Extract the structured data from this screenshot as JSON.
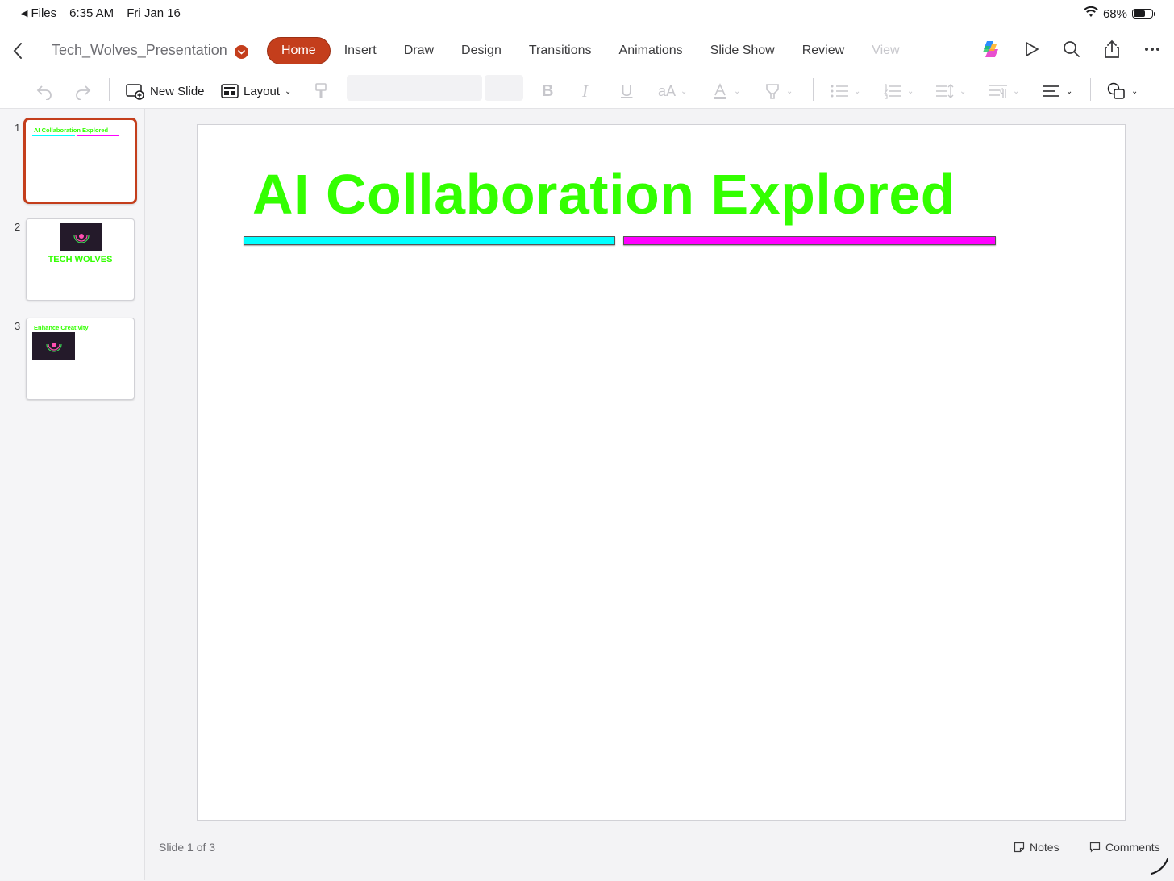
{
  "status_bar": {
    "back_app": "Files",
    "time": "6:35 AM",
    "date": "Fri Jan 16",
    "battery_text": "68%",
    "battery_level": 0.68
  },
  "header": {
    "doc_title": "Tech_Wolves_Presentation",
    "tabs": [
      {
        "label": "Home",
        "active": true
      },
      {
        "label": "Insert"
      },
      {
        "label": "Draw"
      },
      {
        "label": "Design"
      },
      {
        "label": "Transitions"
      },
      {
        "label": "Animations"
      },
      {
        "label": "Slide Show"
      },
      {
        "label": "Review"
      },
      {
        "label": "View"
      }
    ],
    "right_icons": [
      "copilot-icon",
      "play-icon",
      "search-icon",
      "share-icon",
      "more-icon"
    ]
  },
  "toolbar": {
    "new_slide_label": "New Slide",
    "layout_label": "Layout"
  },
  "slides": [
    {
      "number": "1",
      "title": "AI Collaboration Explored"
    },
    {
      "number": "2",
      "title": "TECH WOLVES"
    },
    {
      "number": "3",
      "title": "Enhance Creativity"
    }
  ],
  "canvas": {
    "title": "AI Collaboration Explored",
    "title_color": "#33ff00",
    "bar_colors": [
      "#00ffff",
      "#ff00ff"
    ]
  },
  "footer": {
    "slide_indicator": "Slide 1 of 3",
    "notes_label": "Notes",
    "comments_label": "Comments"
  },
  "colors": {
    "accent": "#c43e1c"
  }
}
